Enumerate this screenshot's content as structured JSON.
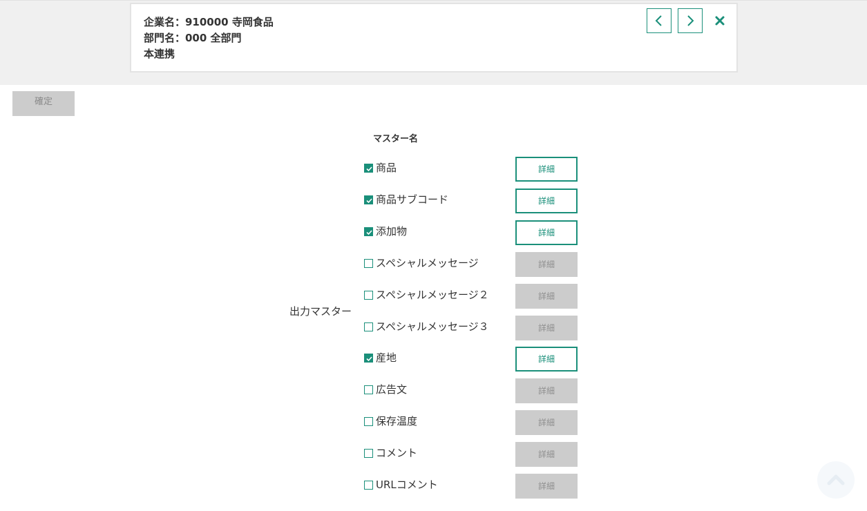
{
  "header": {
    "company_line": "企業名：910000 寺岡食品",
    "department_line": "部門名：000 全部門",
    "mode_line": "本連携"
  },
  "icons": {
    "prev": "chevron-left-icon",
    "next": "chevron-right-icon",
    "close": "close-icon",
    "scroll_top": "chevron-up-icon"
  },
  "colors": {
    "accent": "#1a8f7a",
    "disabled_bg": "#cccccc",
    "band_bg": "#f0f0f0"
  },
  "toolbar": {
    "confirm_label": "確定"
  },
  "table": {
    "column_header": "マスター名",
    "row_label": "出力マスター"
  },
  "masters": [
    {
      "label": "商品",
      "checked": true,
      "detail_label": "詳細"
    },
    {
      "label": "商品サブコード",
      "checked": true,
      "detail_label": "詳細"
    },
    {
      "label": "添加物",
      "checked": true,
      "detail_label": "詳細"
    },
    {
      "label": "スペシャルメッセージ",
      "checked": false,
      "detail_label": "詳細"
    },
    {
      "label": "スペシャルメッセージ２",
      "checked": false,
      "detail_label": "詳細"
    },
    {
      "label": "スペシャルメッセージ３",
      "checked": false,
      "detail_label": "詳細"
    },
    {
      "label": "産地",
      "checked": true,
      "detail_label": "詳細"
    },
    {
      "label": "広告文",
      "checked": false,
      "detail_label": "詳細"
    },
    {
      "label": "保存温度",
      "checked": false,
      "detail_label": "詳細"
    },
    {
      "label": "コメント",
      "checked": false,
      "detail_label": "詳細"
    },
    {
      "label": "URLコメント",
      "checked": false,
      "detail_label": "詳細"
    }
  ]
}
